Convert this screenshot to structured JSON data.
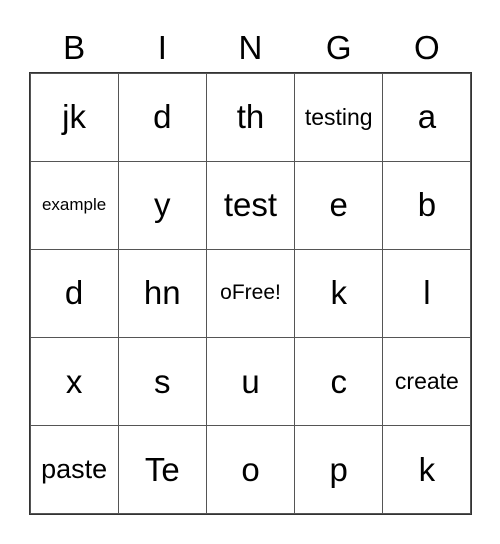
{
  "header": [
    "B",
    "I",
    "N",
    "G",
    "O"
  ],
  "rows": [
    [
      "jk",
      "d",
      "th",
      "testing",
      "a"
    ],
    [
      "example",
      "y",
      "test",
      "e",
      "b"
    ],
    [
      "d",
      "hn",
      "oFree!",
      "k",
      "l"
    ],
    [
      "x",
      "s",
      "u",
      "c",
      "create"
    ],
    [
      "paste",
      "Te",
      "o",
      "p",
      "k"
    ]
  ]
}
